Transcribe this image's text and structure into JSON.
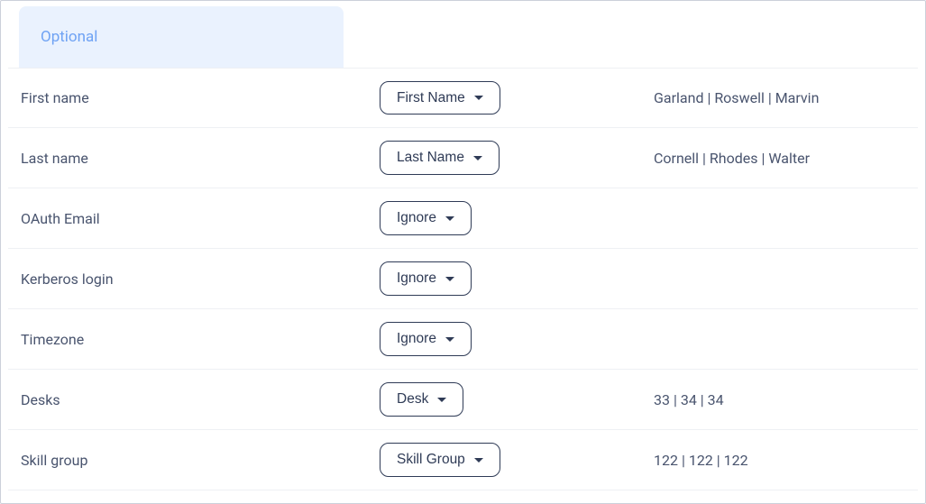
{
  "tab": {
    "label": "Optional"
  },
  "rows": [
    {
      "label": "First name",
      "select": "First Name",
      "sample": "Garland | Roswell | Marvin"
    },
    {
      "label": "Last name",
      "select": "Last Name",
      "sample": "Cornell | Rhodes | Walter"
    },
    {
      "label": "OAuth Email",
      "select": "Ignore",
      "sample": ""
    },
    {
      "label": "Kerberos login",
      "select": "Ignore",
      "sample": ""
    },
    {
      "label": "Timezone",
      "select": "Ignore",
      "sample": ""
    },
    {
      "label": "Desks",
      "select": "Desk",
      "sample": "33 | 34 | 34"
    },
    {
      "label": "Skill group",
      "select": "Skill Group",
      "sample": "122 | 122 | 122"
    }
  ]
}
